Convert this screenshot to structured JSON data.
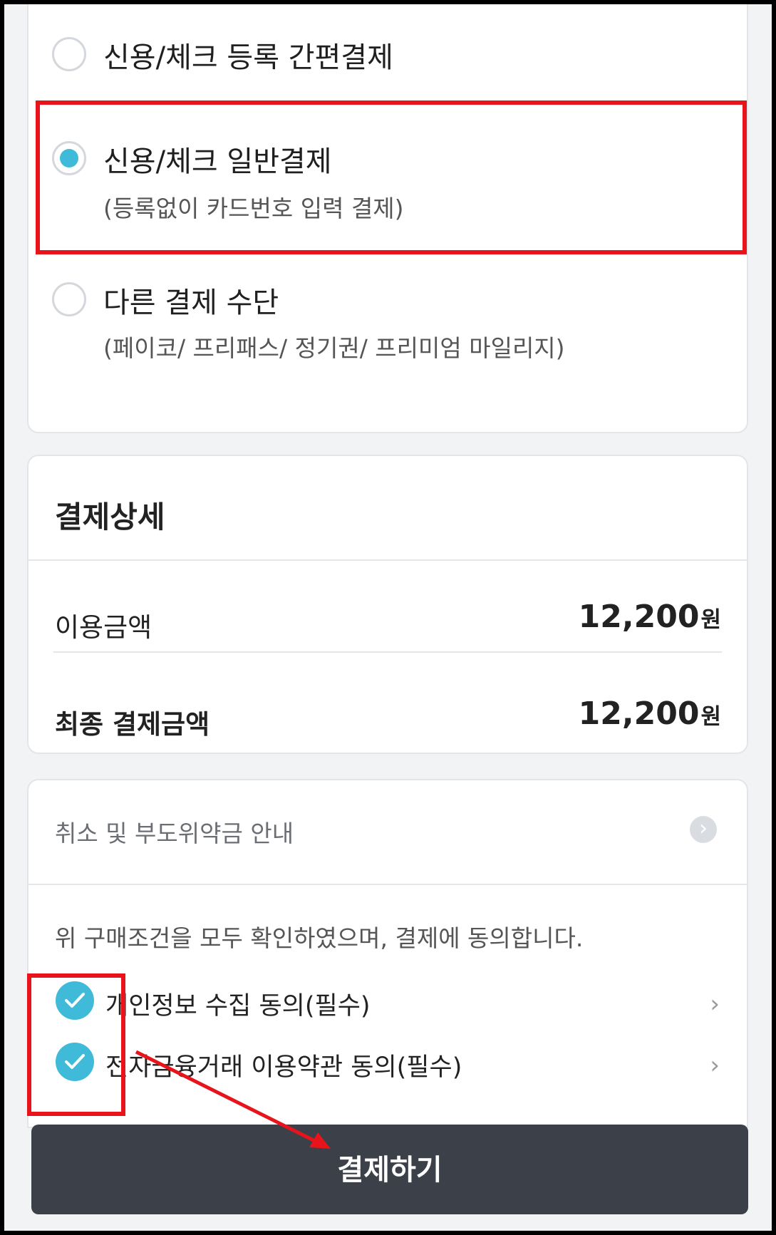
{
  "payment_methods": {
    "options": [
      {
        "label": "신용/체크 등록 간편결제",
        "sub": "",
        "selected": false
      },
      {
        "label": "신용/체크 일반결제",
        "sub": "(등록없이 카드번호 입력 결제)",
        "selected": true
      },
      {
        "label": "다른 결제 수단",
        "sub": "(페이코/ 프리패스/ 정기권/ 프리미엄 마일리지)",
        "selected": false
      }
    ]
  },
  "detail": {
    "title": "결제상세",
    "usage_label": "이용금액",
    "usage_value": "12,200",
    "final_label": "최종 결제금액",
    "final_value": "12,200",
    "currency_unit": "원"
  },
  "agreement": {
    "notice": "취소 및 부도위약금 안내",
    "intro": "위 구매조건을 모두 확인하였으며, 결제에 동의합니다.",
    "items": [
      {
        "label": "개인정보 수집 동의(필수)",
        "checked": true
      },
      {
        "label": "전자금융거래 이용약관 동의(필수)",
        "checked": true
      }
    ]
  },
  "pay_button_label": "결제하기",
  "colors": {
    "accent": "#3fbad8",
    "button_bg": "#3b4049",
    "annotation": "#e8141b"
  },
  "icons": {
    "notice_arrow": "chevron-right-circle-icon",
    "agree_chevron": "chevron-right-icon",
    "check": "check-icon"
  }
}
